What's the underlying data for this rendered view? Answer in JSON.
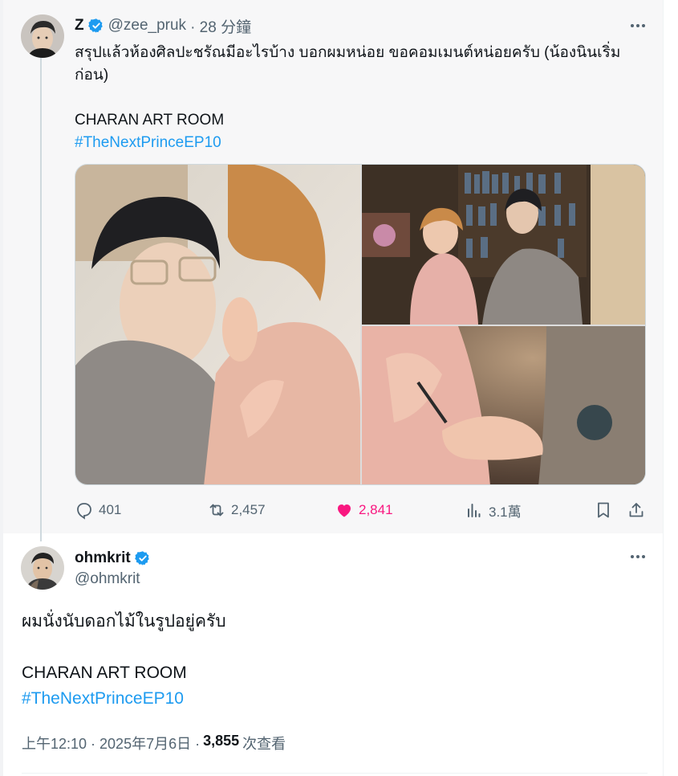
{
  "parent_tweet": {
    "name": "Z",
    "handle": "@zee_pruk",
    "time": "· 28 分鐘",
    "text_lines": [
      "สรุปแล้วห้องศิลปะชรัณมีอะไรบ้าง บอกผมหน่อย ขอคอมเมนต์หน่อยครับ (น้องนินเริ่ม",
      "ก่อน)",
      "",
      "CHARAN ART ROOM"
    ],
    "hashtag": "#TheNextPrinceEP10",
    "stats": {
      "replies": "401",
      "retweets": "2,457",
      "likes": "2,841",
      "views": "3.1萬"
    }
  },
  "reply_tweet": {
    "name": "ohmkrit",
    "handle": "@ohmkrit",
    "text_lines": [
      "ผมนั่งนับดอกไม้ในรูปอยู่ครับ",
      "",
      "CHARAN ART ROOM"
    ],
    "hashtag": "#TheNextPrinceEP10",
    "timestamp": "上午12:10 · 2025年7月6日 ·",
    "view_count": "3,855",
    "view_label": "次查看"
  },
  "icons": {
    "verified": "verified-badge-icon",
    "reply": "reply-icon",
    "retweet": "retweet-icon",
    "like": "heart-icon",
    "views": "views-icon",
    "bookmark": "bookmark-icon",
    "share": "share-icon",
    "more": "more-icon"
  },
  "colors": {
    "accent": "#1d9bf0",
    "like": "#f91880",
    "secondary_text": "#536471",
    "parent_background": "#f7f7f8"
  }
}
